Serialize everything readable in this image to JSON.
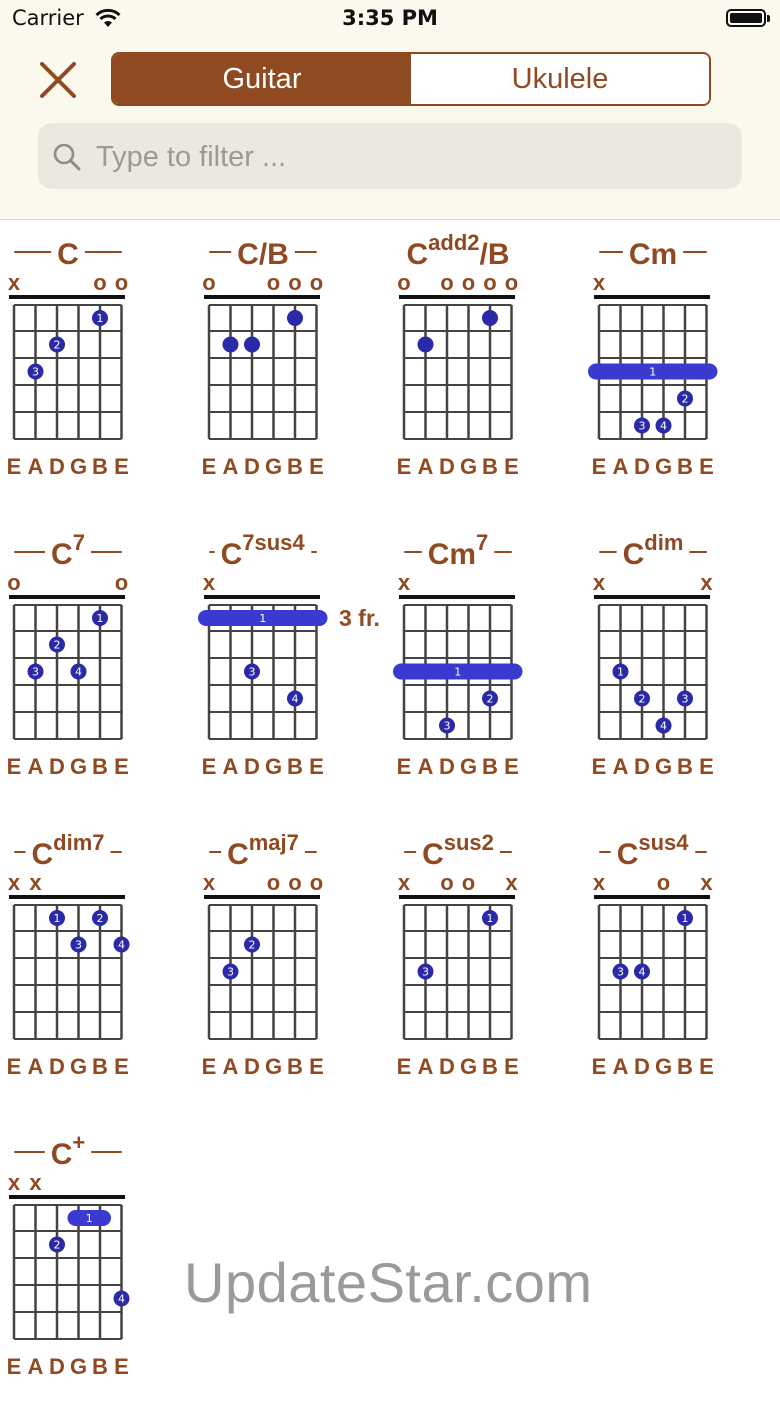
{
  "status_bar": {
    "carrier": "Carrier",
    "time": "3:35 PM"
  },
  "segmented": {
    "guitar": "Guitar",
    "ukulele": "Ukulele",
    "selected": "Guitar"
  },
  "search": {
    "placeholder": "Type to filter ..."
  },
  "colors": {
    "accent": "#8f4a22",
    "finger": "#2a2aa8",
    "barre": "#3a3ad0",
    "grid": "#444444"
  },
  "tuning": [
    "E",
    "A",
    "D",
    "G",
    "B",
    "E"
  ],
  "chords": [
    {
      "root": "C",
      "sup": "",
      "suffix": "",
      "open": [
        "x",
        "",
        "",
        "",
        "o",
        "o"
      ],
      "fret": "",
      "dots": [
        {
          "s": 5,
          "f": 1,
          "n": "1"
        },
        {
          "s": 3,
          "f": 2,
          "n": "2"
        },
        {
          "s": 2,
          "f": 3,
          "n": "3"
        }
      ],
      "barre": null
    },
    {
      "root": "C",
      "sup": "",
      "suffix": "/B",
      "open": [
        "o",
        "",
        "",
        "o",
        "o",
        "o"
      ],
      "fret": "",
      "dots": [
        {
          "s": 2,
          "f": 2,
          "n": ""
        },
        {
          "s": 3,
          "f": 2,
          "n": ""
        },
        {
          "s": 5,
          "f": 1,
          "n": ""
        }
      ],
      "barre": null
    },
    {
      "root": "C",
      "sup": "add2",
      "suffix": "/B",
      "open": [
        "o",
        "",
        "o",
        "o",
        "o",
        "o"
      ],
      "fret": "",
      "dots": [
        {
          "s": 2,
          "f": 2,
          "n": ""
        },
        {
          "s": 5,
          "f": 1,
          "n": ""
        }
      ],
      "barre": null
    },
    {
      "root": "Cm",
      "sup": "",
      "suffix": "",
      "open": [
        "x",
        "",
        "",
        "",
        "",
        ""
      ],
      "fret": "",
      "dots": [
        {
          "s": 5,
          "f": 4,
          "n": "2"
        },
        {
          "s": 3,
          "f": 5,
          "n": "3"
        },
        {
          "s": 4,
          "f": 5,
          "n": "4"
        }
      ],
      "barre": {
        "f": 3,
        "from": 1,
        "to": 6,
        "n": "1"
      }
    },
    {
      "root": "C",
      "sup": "7",
      "suffix": "",
      "open": [
        "o",
        "",
        "",
        "",
        "",
        "o"
      ],
      "fret": "",
      "dots": [
        {
          "s": 5,
          "f": 1,
          "n": "1"
        },
        {
          "s": 3,
          "f": 2,
          "n": "2"
        },
        {
          "s": 2,
          "f": 3,
          "n": "3"
        },
        {
          "s": 4,
          "f": 3,
          "n": "4"
        }
      ],
      "barre": null
    },
    {
      "root": "C",
      "sup": "7sus4",
      "suffix": "",
      "open": [
        "x",
        "",
        "",
        "",
        "",
        ""
      ],
      "fret": "3 fr.",
      "dots": [
        {
          "s": 3,
          "f": 3,
          "n": "3"
        },
        {
          "s": 5,
          "f": 4,
          "n": "4"
        }
      ],
      "barre": {
        "f": 1,
        "from": 1,
        "to": 6,
        "n": "1"
      }
    },
    {
      "root": "Cm",
      "sup": "7",
      "suffix": "",
      "open": [
        "x",
        "",
        "",
        "",
        "",
        ""
      ],
      "fret": "",
      "dots": [
        {
          "s": 5,
          "f": 4,
          "n": "2"
        },
        {
          "s": 3,
          "f": 5,
          "n": "3"
        }
      ],
      "barre": {
        "f": 3,
        "from": 1,
        "to": 6,
        "n": "1"
      }
    },
    {
      "root": "C",
      "sup": "dim",
      "suffix": "",
      "open": [
        "x",
        "",
        "",
        "",
        "",
        "x"
      ],
      "fret": "",
      "dots": [
        {
          "s": 2,
          "f": 3,
          "n": "1"
        },
        {
          "s": 3,
          "f": 4,
          "n": "2"
        },
        {
          "s": 5,
          "f": 4,
          "n": "3"
        },
        {
          "s": 4,
          "f": 5,
          "n": "4"
        }
      ],
      "barre": null
    },
    {
      "root": "C",
      "sup": "dim7",
      "suffix": "",
      "open": [
        "x",
        "x",
        "",
        "",
        "",
        ""
      ],
      "fret": "",
      "dots": [
        {
          "s": 3,
          "f": 1,
          "n": "1"
        },
        {
          "s": 5,
          "f": 1,
          "n": "2"
        },
        {
          "s": 4,
          "f": 2,
          "n": "3"
        },
        {
          "s": 6,
          "f": 2,
          "n": "4"
        }
      ],
      "barre": null
    },
    {
      "root": "C",
      "sup": "maj7",
      "suffix": "",
      "open": [
        "x",
        "",
        "",
        "o",
        "o",
        "o"
      ],
      "fret": "",
      "dots": [
        {
          "s": 3,
          "f": 2,
          "n": "2"
        },
        {
          "s": 2,
          "f": 3,
          "n": "3"
        }
      ],
      "barre": null
    },
    {
      "root": "C",
      "sup": "sus2",
      "suffix": "",
      "open": [
        "x",
        "",
        "o",
        "o",
        "",
        "x"
      ],
      "fret": "",
      "dots": [
        {
          "s": 5,
          "f": 1,
          "n": "1"
        },
        {
          "s": 2,
          "f": 3,
          "n": "3"
        }
      ],
      "barre": null
    },
    {
      "root": "C",
      "sup": "sus4",
      "suffix": "",
      "open": [
        "x",
        "",
        "",
        "o",
        "",
        "x"
      ],
      "fret": "",
      "dots": [
        {
          "s": 5,
          "f": 1,
          "n": "1"
        },
        {
          "s": 2,
          "f": 3,
          "n": "3"
        },
        {
          "s": 3,
          "f": 3,
          "n": "4"
        }
      ],
      "barre": null
    },
    {
      "root": "C",
      "sup": "+",
      "suffix": "",
      "open": [
        "x",
        "x",
        "",
        "",
        "",
        ""
      ],
      "fret": "",
      "dots": [
        {
          "s": 3,
          "f": 2,
          "n": "2"
        },
        {
          "s": 6,
          "f": 4,
          "n": "4"
        }
      ],
      "barre": {
        "f": 1,
        "from": 4,
        "to": 5,
        "n": "1"
      }
    }
  ],
  "watermark": "UpdateStar.com"
}
